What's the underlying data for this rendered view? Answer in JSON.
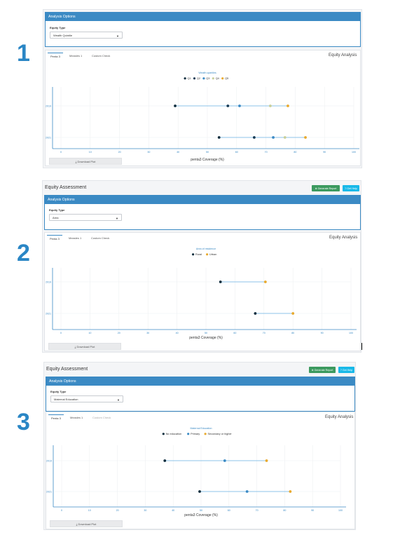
{
  "colors": {
    "accent": "#3b8ac4",
    "axis": "#3b8ac4",
    "tick_text": "#3b8ac4",
    "palette": [
      "#0f2d3d",
      "#163a54",
      "#3b8ac4",
      "#c8cf9a",
      "#e8a92d"
    ]
  },
  "panels": [
    {
      "number": "1",
      "show_header": false,
      "options_title": "Analysis Options",
      "equity_type_label": "Equity Type",
      "equity_type_value": "Wealth Quintile",
      "tabs": [
        {
          "label": "Penta 3",
          "state": "active"
        },
        {
          "label": "Measles 1",
          "state": "normal"
        },
        {
          "label": "Custom Check",
          "state": "normal"
        }
      ],
      "analysis_label": "Equity Analysis",
      "download_label": "⤓ Download Plot",
      "chart_data": {
        "type": "scatter",
        "legend_title": "Wealth quintiles",
        "legend_position": "top-center",
        "xlabel": "penta3 Coverage (%)",
        "xlim": [
          0,
          100
        ],
        "xticks": [
          0,
          10,
          20,
          30,
          40,
          50,
          60,
          70,
          80,
          90,
          100
        ],
        "categories": [
          "2019",
          "2021"
        ],
        "series": [
          {
            "name": "Q1",
            "color": "#0f2d3d",
            "values": [
              39,
              54
            ]
          },
          {
            "name": "Q2",
            "color": "#163a54",
            "values": [
              57,
              66
            ]
          },
          {
            "name": "Q3",
            "color": "#3b8ac4",
            "values": [
              61,
              72.5
            ]
          },
          {
            "name": "Q4",
            "color": "#c8cf9a",
            "values": [
              71.5,
              76.5
            ]
          },
          {
            "name": "Q5",
            "color": "#e8a92d",
            "values": [
              77.5,
              83.5
            ]
          }
        ]
      }
    },
    {
      "number": "2",
      "show_header": true,
      "header_title": "Equity Assessment",
      "report_button": "⊕ Generate Report",
      "help_button": "? Get Help",
      "options_title": "Analysis Options",
      "equity_type_label": "Equity Type",
      "equity_type_value": "Area",
      "tabs": [
        {
          "label": "Penta 3",
          "state": "active"
        },
        {
          "label": "Measles 1",
          "state": "normal"
        },
        {
          "label": "Custom Check",
          "state": "normal"
        }
      ],
      "analysis_label": "Equity Analysis",
      "download_label": "⤓ Download Plot",
      "chart_data": {
        "type": "scatter",
        "legend_title": "Area of residence",
        "legend_position": "top-center",
        "xlabel": "penta3 Coverage (%)",
        "xlim": [
          0,
          100
        ],
        "xticks": [
          0,
          10,
          20,
          30,
          40,
          50,
          60,
          70,
          80,
          90,
          100
        ],
        "categories": [
          "2019",
          "2021"
        ],
        "series": [
          {
            "name": "Rural",
            "color": "#0f2d3d",
            "values": [
              55,
              67
            ]
          },
          {
            "name": "Urban",
            "color": "#e8a92d",
            "values": [
              70.5,
              80
            ]
          }
        ]
      }
    },
    {
      "number": "3",
      "show_header": true,
      "header_title": "Equity Assessment",
      "report_button": "⊕ Generate Report",
      "help_button": "? Get Help",
      "options_title": "Analysis Options",
      "equity_type_label": "Equity Type",
      "equity_type_value": "Maternal Education",
      "tabs": [
        {
          "label": "Penta 3",
          "state": "active"
        },
        {
          "label": "Measles 1",
          "state": "normal"
        },
        {
          "label": "Custom Check",
          "state": "faded"
        }
      ],
      "analysis_label": "Equity Analysis",
      "download_label": "⤓ Download Plot",
      "chart_data": {
        "type": "scatter",
        "legend_title": "Maternal Education",
        "legend_position": "top-center",
        "xlabel": "penta3 Coverage (%)",
        "xlim": [
          0,
          100
        ],
        "xticks": [
          0,
          10,
          20,
          30,
          40,
          50,
          60,
          70,
          80,
          90,
          100
        ],
        "categories": [
          "2019",
          "2021"
        ],
        "series": [
          {
            "name": "No education",
            "color": "#0f2d3d",
            "values": [
              37,
              49.5
            ]
          },
          {
            "name": "Primary",
            "color": "#3b8ac4",
            "values": [
              58.5,
              66.5
            ]
          },
          {
            "name": "Secondary or higher",
            "color": "#e8a92d",
            "values": [
              73.5,
              82
            ]
          }
        ]
      }
    }
  ]
}
